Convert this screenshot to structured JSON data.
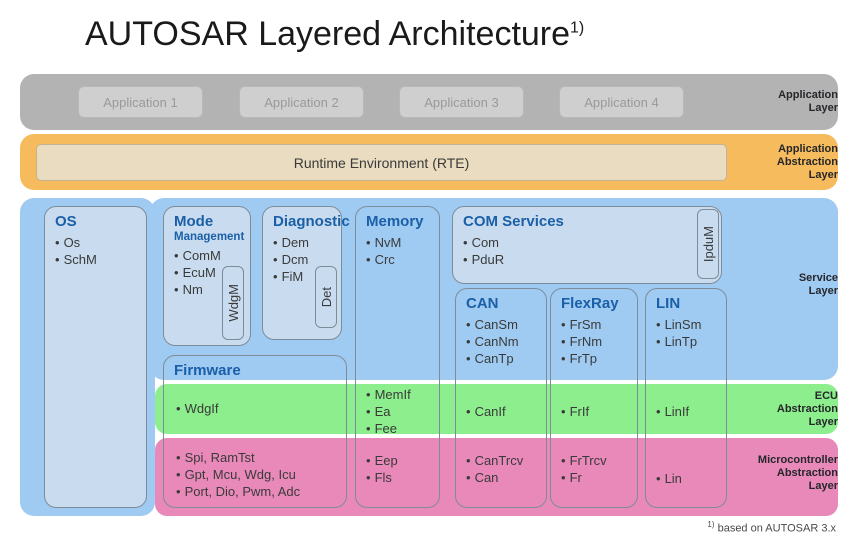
{
  "title": {
    "text": "AUTOSAR Layered Architecture",
    "footnote_marker": "1)"
  },
  "footnote": {
    "marker": "1)",
    "text": "based on AUTOSAR 3.x"
  },
  "layers": {
    "application": {
      "label": "Application\nLayer",
      "line1": "Application",
      "line2": "Layer",
      "color": "#b3b3b3"
    },
    "application_abstraction": {
      "line1": "Application",
      "line2": "Abstraction",
      "line3": "Layer",
      "color": "#f5bb5c"
    },
    "service": {
      "line1": "Service",
      "line2": "Layer",
      "color": "#9fcbf2"
    },
    "ecu_abstraction": {
      "line1": "ECU",
      "line2": "Abstraction",
      "line3": "Layer",
      "color": "#8cee8c"
    },
    "microcontroller_abstraction": {
      "line1": "Microcontroller",
      "line2": "Abstraction",
      "line3": "Layer",
      "color": "#e889b9"
    }
  },
  "applications": [
    {
      "label": "Application 1"
    },
    {
      "label": "Application 2"
    },
    {
      "label": "Application 3"
    },
    {
      "label": "Application 4"
    }
  ],
  "rte": {
    "label": "Runtime Environment (RTE)"
  },
  "modules": {
    "os": {
      "title": "OS",
      "items": [
        "Os",
        "SchM"
      ]
    },
    "mode": {
      "title": "Mode",
      "subtitle": "Management",
      "items": [
        "ComM",
        "EcuM",
        "Nm"
      ],
      "vertical_box": "WdgM"
    },
    "diagnostic": {
      "title": "Diagnostic",
      "items": [
        "Dem",
        "Dcm",
        "FiM"
      ],
      "vertical_box": "Det"
    },
    "memory": {
      "title": "Memory",
      "service_items": [
        "NvM",
        "Crc"
      ],
      "ecu_items": [
        "MemIf",
        "Ea",
        "Fee"
      ],
      "mcal_items": [
        "Eep",
        "Fls"
      ]
    },
    "com_services": {
      "title": "COM Services",
      "items": [
        "Com",
        "PduR"
      ],
      "vertical_box": "IpduM"
    },
    "can": {
      "title": "CAN",
      "service_items": [
        "CanSm",
        "CanNm",
        "CanTp"
      ],
      "ecu_items": [
        "CanIf"
      ],
      "mcal_items": [
        "CanTrcv",
        "Can"
      ]
    },
    "flexray": {
      "title": "FlexRay",
      "service_items": [
        "FrSm",
        "FrNm",
        "FrTp"
      ],
      "ecu_items": [
        "FrIf"
      ],
      "mcal_items": [
        "FrTrcv",
        "Fr"
      ]
    },
    "lin": {
      "title": "LIN",
      "service_items": [
        "LinSm",
        "LinTp"
      ],
      "ecu_items": [
        "LinIf"
      ],
      "mcal_items": [
        "Lin"
      ]
    },
    "firmware": {
      "title": "Firmware",
      "ecu_items": [
        "WdgIf"
      ],
      "mcal_items": [
        "Spi, RamTst",
        "Gpt, Mcu, Wdg, Icu",
        "Port, Dio, Pwm, Adc"
      ]
    }
  }
}
